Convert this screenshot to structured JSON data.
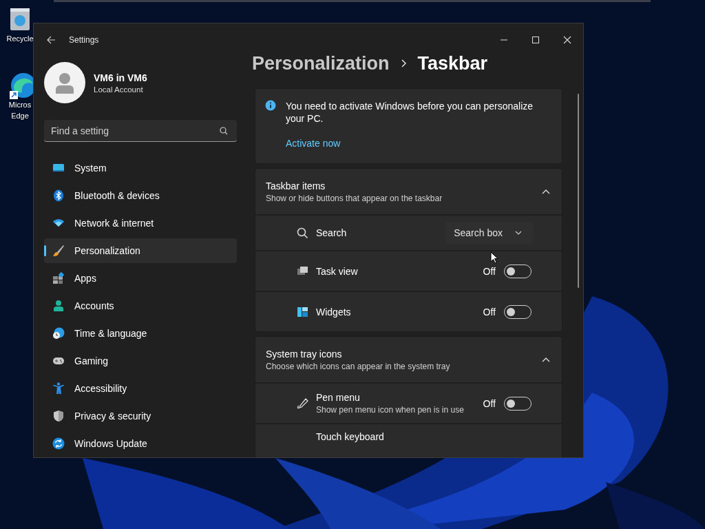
{
  "desktop_icons": [
    {
      "lines": [
        "Recycle"
      ]
    },
    {
      "lines": [
        "Micros",
        "Edge"
      ]
    }
  ],
  "window": {
    "title": "Settings"
  },
  "profile": {
    "name": "VM6 in VM6",
    "account": "Local Account"
  },
  "search": {
    "placeholder": "Find a setting"
  },
  "nav": [
    {
      "label": "System",
      "selected": false
    },
    {
      "label": "Bluetooth & devices",
      "selected": false
    },
    {
      "label": "Network & internet",
      "selected": false
    },
    {
      "label": "Personalization",
      "selected": true
    },
    {
      "label": "Apps",
      "selected": false
    },
    {
      "label": "Accounts",
      "selected": false
    },
    {
      "label": "Time & language",
      "selected": false
    },
    {
      "label": "Gaming",
      "selected": false
    },
    {
      "label": "Accessibility",
      "selected": false
    },
    {
      "label": "Privacy & security",
      "selected": false
    },
    {
      "label": "Windows Update",
      "selected": false
    }
  ],
  "breadcrumb": [
    "Personalization",
    "Taskbar"
  ],
  "banner": {
    "message": "You need to activate Windows before you can personalize your PC.",
    "link": "Activate now"
  },
  "sections": [
    {
      "title": "Taskbar items",
      "subtitle": "Show or hide buttons that appear on the taskbar",
      "expanded": true,
      "rows": [
        {
          "kind": "dropdown",
          "label": "Search",
          "value": "Search box"
        },
        {
          "kind": "toggle",
          "label": "Task view",
          "on": false,
          "state_text": "Off"
        },
        {
          "kind": "toggle",
          "label": "Widgets",
          "on": false,
          "state_text": "Off"
        }
      ]
    },
    {
      "title": "System tray icons",
      "subtitle": "Choose which icons can appear in the system tray",
      "expanded": true,
      "rows": [
        {
          "kind": "toggle",
          "label": "Pen menu",
          "description": "Show pen menu icon when pen is in use",
          "on": false,
          "state_text": "Off"
        },
        {
          "kind": "plain",
          "label": "Touch keyboard"
        }
      ]
    }
  ]
}
